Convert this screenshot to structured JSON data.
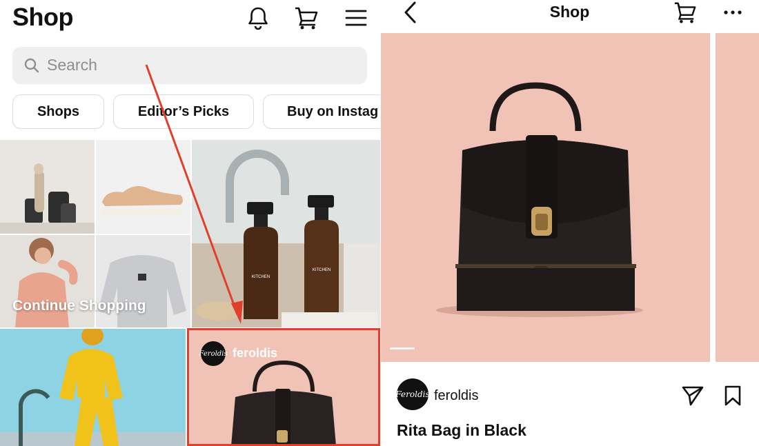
{
  "left_screen": {
    "header": {
      "title": "Shop"
    },
    "icons": {
      "notifications": "bell-icon",
      "cart": "cart-icon",
      "menu": "menu-icon"
    },
    "search": {
      "placeholder": "Search"
    },
    "chips": [
      {
        "label": "Shops"
      },
      {
        "label": "Editor’s Picks"
      },
      {
        "label": "Buy on Instag"
      }
    ],
    "grid": {
      "continue_caption": "Continue Shopping",
      "featured_brand": {
        "name": "feroldis",
        "avatar_text": "Feroldis"
      }
    },
    "colors": {
      "highlight": "#e0402b",
      "arrow": "#e0402b"
    }
  },
  "right_screen": {
    "header": {
      "title": "Shop"
    },
    "icons": {
      "back": "back-icon",
      "cart": "cart-icon",
      "more": "more-icon"
    },
    "product": {
      "brand": "feroldis",
      "avatar_text": "Feroldis",
      "name": "Rita Bag in Black",
      "background": "#f1c2b6"
    },
    "actions": {
      "share": "share-icon",
      "save": "bookmark-icon"
    }
  }
}
